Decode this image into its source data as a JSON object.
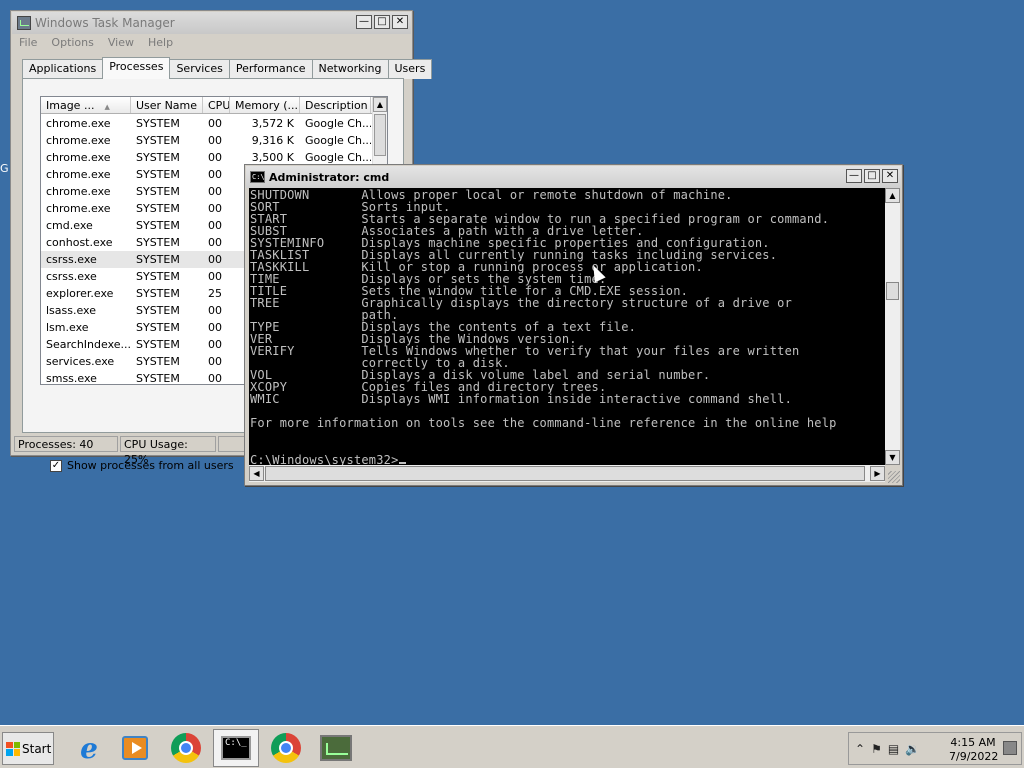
{
  "desktop": {
    "fragment": "G"
  },
  "taskmgr": {
    "title": "Windows Task Manager",
    "menu": [
      "File",
      "Options",
      "View",
      "Help"
    ],
    "tabs": [
      "Applications",
      "Processes",
      "Services",
      "Performance",
      "Networking",
      "Users"
    ],
    "active_tab": "Processes",
    "columns": {
      "image": "Image ...",
      "user": "User Name",
      "cpu": "CPU",
      "memory": "Memory (...",
      "description": "Description"
    },
    "rows": [
      {
        "image": "chrome.exe",
        "user": "SYSTEM",
        "cpu": "00",
        "memory": "3,572 K",
        "description": "Google Ch..."
      },
      {
        "image": "chrome.exe",
        "user": "SYSTEM",
        "cpu": "00",
        "memory": "9,316 K",
        "description": "Google Ch..."
      },
      {
        "image": "chrome.exe",
        "user": "SYSTEM",
        "cpu": "00",
        "memory": "3,500 K",
        "description": "Google Ch..."
      },
      {
        "image": "chrome.exe",
        "user": "SYSTEM",
        "cpu": "00",
        "memory": "",
        "description": ""
      },
      {
        "image": "chrome.exe",
        "user": "SYSTEM",
        "cpu": "00",
        "memory": "",
        "description": ""
      },
      {
        "image": "chrome.exe",
        "user": "SYSTEM",
        "cpu": "00",
        "memory": "",
        "description": ""
      },
      {
        "image": "cmd.exe",
        "user": "SYSTEM",
        "cpu": "00",
        "memory": "",
        "description": ""
      },
      {
        "image": "conhost.exe",
        "user": "SYSTEM",
        "cpu": "00",
        "memory": "",
        "description": ""
      },
      {
        "image": "csrss.exe",
        "user": "SYSTEM",
        "cpu": "00",
        "memory": "",
        "description": "",
        "selected": true
      },
      {
        "image": "csrss.exe",
        "user": "SYSTEM",
        "cpu": "00",
        "memory": "",
        "description": ""
      },
      {
        "image": "explorer.exe",
        "user": "SYSTEM",
        "cpu": "25",
        "memory": "",
        "description": ""
      },
      {
        "image": "lsass.exe",
        "user": "SYSTEM",
        "cpu": "00",
        "memory": "",
        "description": ""
      },
      {
        "image": "lsm.exe",
        "user": "SYSTEM",
        "cpu": "00",
        "memory": "",
        "description": ""
      },
      {
        "image": "SearchIndexe...",
        "user": "SYSTEM",
        "cpu": "00",
        "memory": "",
        "description": ""
      },
      {
        "image": "services.exe",
        "user": "SYSTEM",
        "cpu": "00",
        "memory": "",
        "description": ""
      },
      {
        "image": "smss.exe",
        "user": "SYSTEM",
        "cpu": "00",
        "memory": "",
        "description": ""
      }
    ],
    "show_all_label": "Show processes from all users",
    "show_all_checked": true,
    "status_processes": "Processes: 40",
    "status_cpu": "CPU Usage: 25%"
  },
  "cmd": {
    "title": "Administrator: cmd",
    "lines": [
      "SHUTDOWN       Allows proper local or remote shutdown of machine.",
      "SORT           Sorts input.",
      "START          Starts a separate window to run a specified program or command.",
      "SUBST          Associates a path with a drive letter.",
      "SYSTEMINFO     Displays machine specific properties and configuration.",
      "TASKLIST       Displays all currently running tasks including services.",
      "TASKKILL       Kill or stop a running process or application.",
      "TIME           Displays or sets the system time.",
      "TITLE          Sets the window title for a CMD.EXE session.",
      "TREE           Graphically displays the directory structure of a drive or",
      "               path.",
      "TYPE           Displays the contents of a text file.",
      "VER            Displays the Windows version.",
      "VERIFY         Tells Windows whether to verify that your files are written",
      "               correctly to a disk.",
      "VOL            Displays a disk volume label and serial number.",
      "XCOPY          Copies files and directory trees.",
      "WMIC           Displays WMI information inside interactive command shell.",
      "",
      "For more information on tools see the command-line reference in the online help",
      "",
      ""
    ],
    "prompt": "C:\\Windows\\system32>"
  },
  "taskbar": {
    "start_label": "Start",
    "items": [
      "internet-explorer",
      "windows-media-player",
      "chrome",
      "cmd",
      "chrome",
      "task-manager"
    ],
    "clock_time": "4:15 AM",
    "clock_date": "7/9/2022"
  },
  "colors": {
    "desktop": "#3a6ea5",
    "console_bg": "#000000",
    "console_fg": "#c0c0c0"
  }
}
